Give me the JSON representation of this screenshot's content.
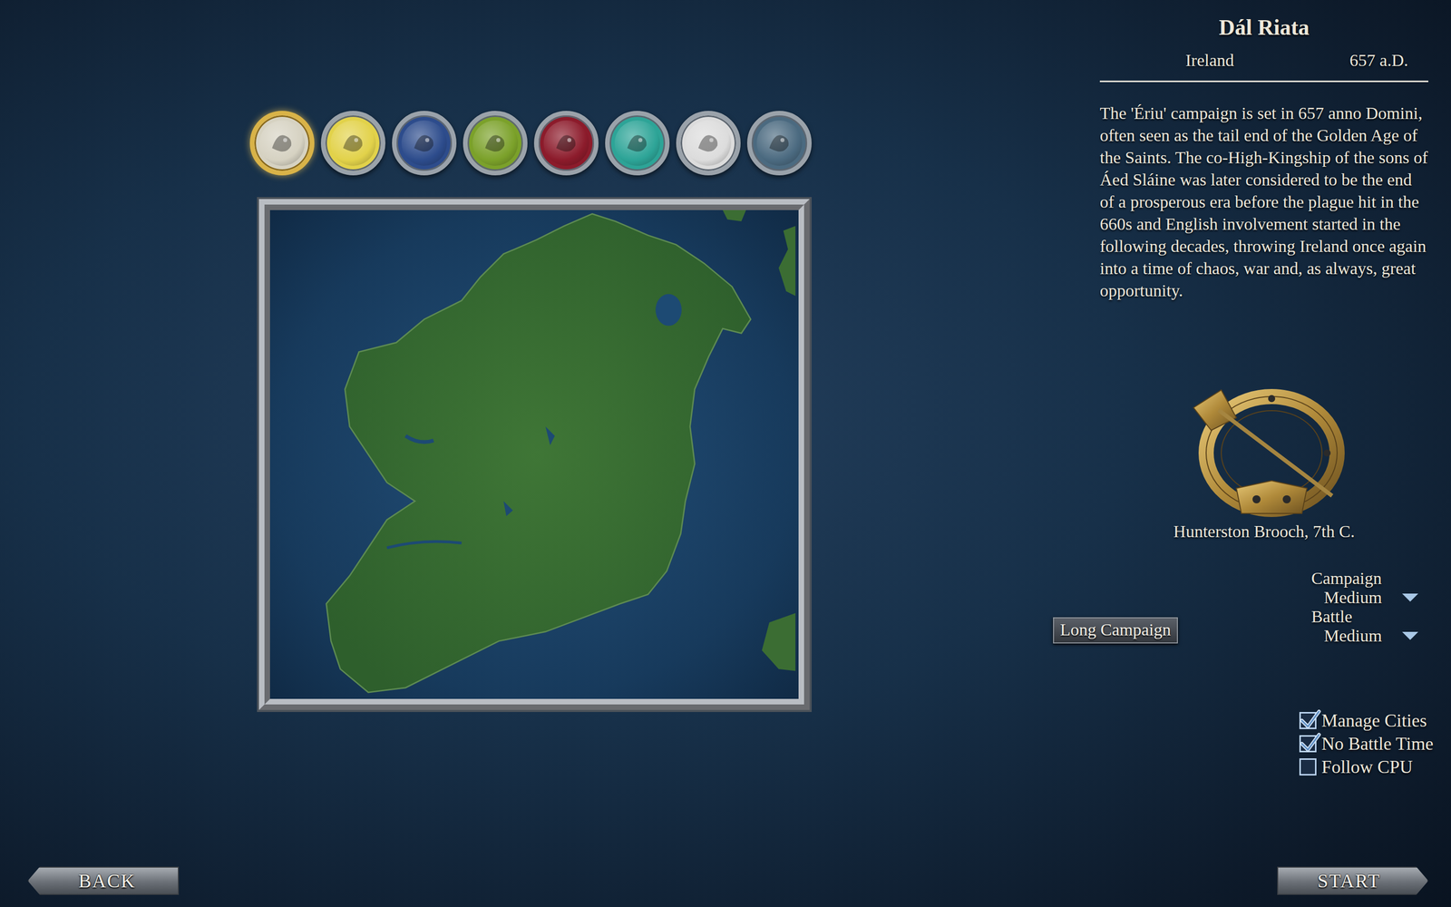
{
  "faction": {
    "name": "Dál Riata",
    "region": "Ireland",
    "date": "657 a.D."
  },
  "factions": [
    {
      "selected": true,
      "color": "#d6d2c2"
    },
    {
      "selected": false,
      "color": "#e2d24a"
    },
    {
      "selected": false,
      "color": "#2d4c8c"
    },
    {
      "selected": false,
      "color": "#7ba12a"
    },
    {
      "selected": false,
      "color": "#8c1b2b"
    },
    {
      "selected": false,
      "color": "#2da497"
    },
    {
      "selected": false,
      "color": "#dcdcdc"
    },
    {
      "selected": false,
      "color": "#4b6a80"
    }
  ],
  "description": "The 'Ériu' campaign is set in 657 anno Domini, often seen as the tail end of the Golden Age of the Saints. The co-High-Kingship of the sons of Áed Sláine was later considered to be the end of a prosperous era before the plague hit in the 660s and English involvement started in the following decades, throwing Ireland once again into a time of chaos, war and, as always, great opportunity.",
  "image_caption": "Hunterston Brooch, 7th C.",
  "long_campaign": "Long Campaign",
  "difficulty": [
    {
      "label": "Campaign",
      "value": "Medium"
    },
    {
      "label": "Battle",
      "value": "Medium"
    }
  ],
  "options": [
    {
      "label": "Manage Cities",
      "checked": true
    },
    {
      "label": "No Battle Time",
      "checked": true
    },
    {
      "label": "Follow CPU",
      "checked": false
    }
  ],
  "buttons": {
    "back": "BACK",
    "start": "START"
  }
}
